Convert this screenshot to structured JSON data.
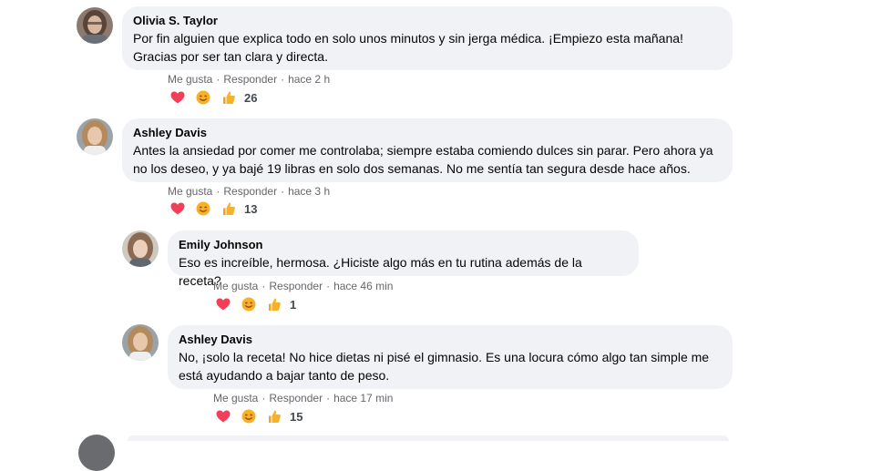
{
  "comments": [
    {
      "author": "Olivia S. Taylor",
      "text_lines": [
        "Por fin alguien que explica todo en solo unos minutos y sin jerga médica. ¡Empiezo esta mañana!",
        "Gracias por ser tan clara y directa."
      ],
      "like": "Me gusta",
      "reply": "Responder",
      "time": "hace 2 h",
      "reaction_count": "26"
    },
    {
      "author": "Ashley Davis",
      "text_lines": [
        "Antes la ansiedad por comer me controlaba; siempre estaba comiendo dulces sin parar. Pero ahora ya",
        "no los deseo, y ya bajé 19 libras en solo dos semanas. No me sentía tan segura desde hace años."
      ],
      "like": "Me gusta",
      "reply": "Responder",
      "time": "hace 3 h",
      "reaction_count": "13"
    },
    {
      "author": "Emily Johnson",
      "text_lines": [
        "Eso es increíble, hermosa. ¿Hiciste algo más en tu rutina además de la receta?"
      ],
      "like": "Me gusta",
      "reply": "Responder",
      "time": "hace 46 min",
      "reaction_count": "1"
    },
    {
      "author": "Ashley Davis",
      "text_lines": [
        "No, ¡solo la receta! No hice dietas ni pisé el gimnasio. Es una locura cómo algo tan simple me",
        "está ayudando a bajar tanto de peso."
      ],
      "like": "Me gusta",
      "reply": "Responder",
      "time": "hace 17 min",
      "reaction_count": "15"
    }
  ],
  "icons": {
    "reactions": [
      "heart-icon",
      "smile-icon",
      "thumbs-up-icon"
    ]
  },
  "colors": {
    "bubble": "#f0f2f5",
    "meta": "#65676b",
    "heart": "#f33e58",
    "smile": "#f7b125",
    "like": "#f7b125"
  }
}
